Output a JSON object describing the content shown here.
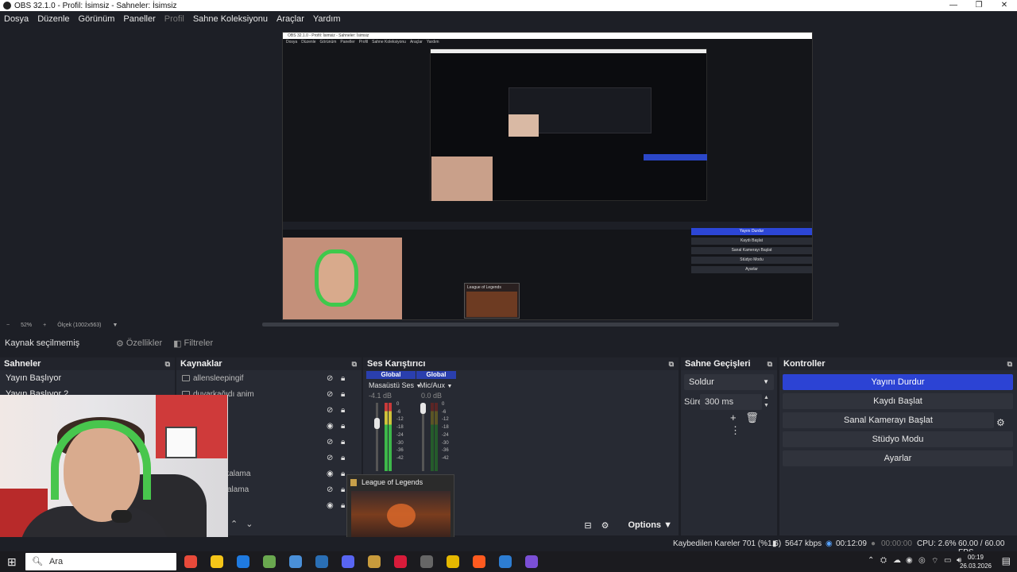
{
  "window": {
    "title": "OBS 32.1.0 - Profil: İsimsiz - Sahneler: İsimsiz",
    "controls": [
      "—",
      "❐",
      "✕"
    ]
  },
  "menu": [
    {
      "label": "Dosya",
      "disabled": false
    },
    {
      "label": "Düzenle",
      "disabled": false
    },
    {
      "label": "Görünüm",
      "disabled": false
    },
    {
      "label": "Paneller",
      "disabled": false
    },
    {
      "label": "Profil",
      "disabled": true
    },
    {
      "label": "Sahne Koleksiyonu",
      "disabled": false
    },
    {
      "label": "Araçlar",
      "disabled": false
    },
    {
      "label": "Yardım",
      "disabled": false
    }
  ],
  "preview": {
    "zoom": "52%",
    "scale_label": "Ölçek (1002x563)",
    "nested": {
      "menu": [
        "Dosya",
        "Düzenle",
        "Görünüm",
        "Paneller",
        "Profil",
        "Sahne Koleksiyonu",
        "Araçlar",
        "Yardım"
      ],
      "buttons": [
        "Yayını Durdur",
        "Kaydı Başlat",
        "Sanal Kamerayı Başlat",
        "Stüdyo Modu",
        "Ayarlar"
      ],
      "lol_label": "League of Legends"
    }
  },
  "toolbar": {
    "no_source": "Kaynak seçilmemiş",
    "properties": "Özellikler",
    "filters": "Filtreler"
  },
  "docks": {
    "scenes": {
      "title": "Sahneler",
      "items": [
        "Yayın Başlıyor",
        "Yayın Başlıyor 2"
      ]
    },
    "sources": {
      "title": "Kaynaklar",
      "items": [
        {
          "name": "allensleepingif",
          "visible": false
        },
        {
          "name": "duvarkağıdı anim",
          "visible": false
        },
        {
          "name": "",
          "visible": false
        },
        {
          "name": "",
          "visible": true
        },
        {
          "name": "",
          "visible": false
        },
        {
          "name": "",
          "visible": false
        },
        {
          "name": "Ekran Yakalama",
          "visible": true
        },
        {
          "name": "Oyun Yakalama",
          "visible": false
        },
        {
          "name": "",
          "visible": true
        }
      ]
    },
    "mixer": {
      "title": "Ses Karıştırıcı",
      "channels": [
        {
          "header": "Global",
          "name": "Masaüstü Ses",
          "db": "-4.1 dB"
        },
        {
          "header": "Global",
          "name": "Mic/Aux",
          "db": "0.0 dB"
        }
      ],
      "scale": [
        "0",
        "-6",
        "-12",
        "-18",
        "-24",
        "-30",
        "-36",
        "-42"
      ],
      "options_label": "Options"
    },
    "transitions": {
      "title": "Sahne Geçişleri",
      "selected": "Soldur",
      "duration_label": "Süre",
      "duration": "300 ms"
    },
    "controls": {
      "title": "Kontroller",
      "buttons": [
        "Yayını Durdur",
        "Kaydı Başlat",
        "Sanal Kamerayı Başlat",
        "Stüdyo Modu",
        "Ayarlar"
      ]
    }
  },
  "popup": {
    "title": "League of Legends"
  },
  "status": {
    "dropped": "Kaybedilen Kareler 701 (%1.6)",
    "bitrate": "5647 kbps",
    "stream_time": "00:12:09",
    "rec_time": "00:00:00",
    "cpu": "CPU: 2.6%",
    "fps": "60.00 / 60.00 FPS"
  },
  "taskbar": {
    "search_placeholder": "Ara",
    "time": "00:19",
    "date": "26.03.2026",
    "app_colors": [
      "#e84a3a",
      "#f5c518",
      "#1f7ae0",
      "#6aa84f",
      "#4a90d9",
      "#2a6fb5",
      "#5865f2",
      "#c89b3c",
      "#d81b3a",
      "#666666",
      "#e5b800",
      "#ff5a1f",
      "#2d7dd2",
      "#7b4fd6"
    ]
  }
}
